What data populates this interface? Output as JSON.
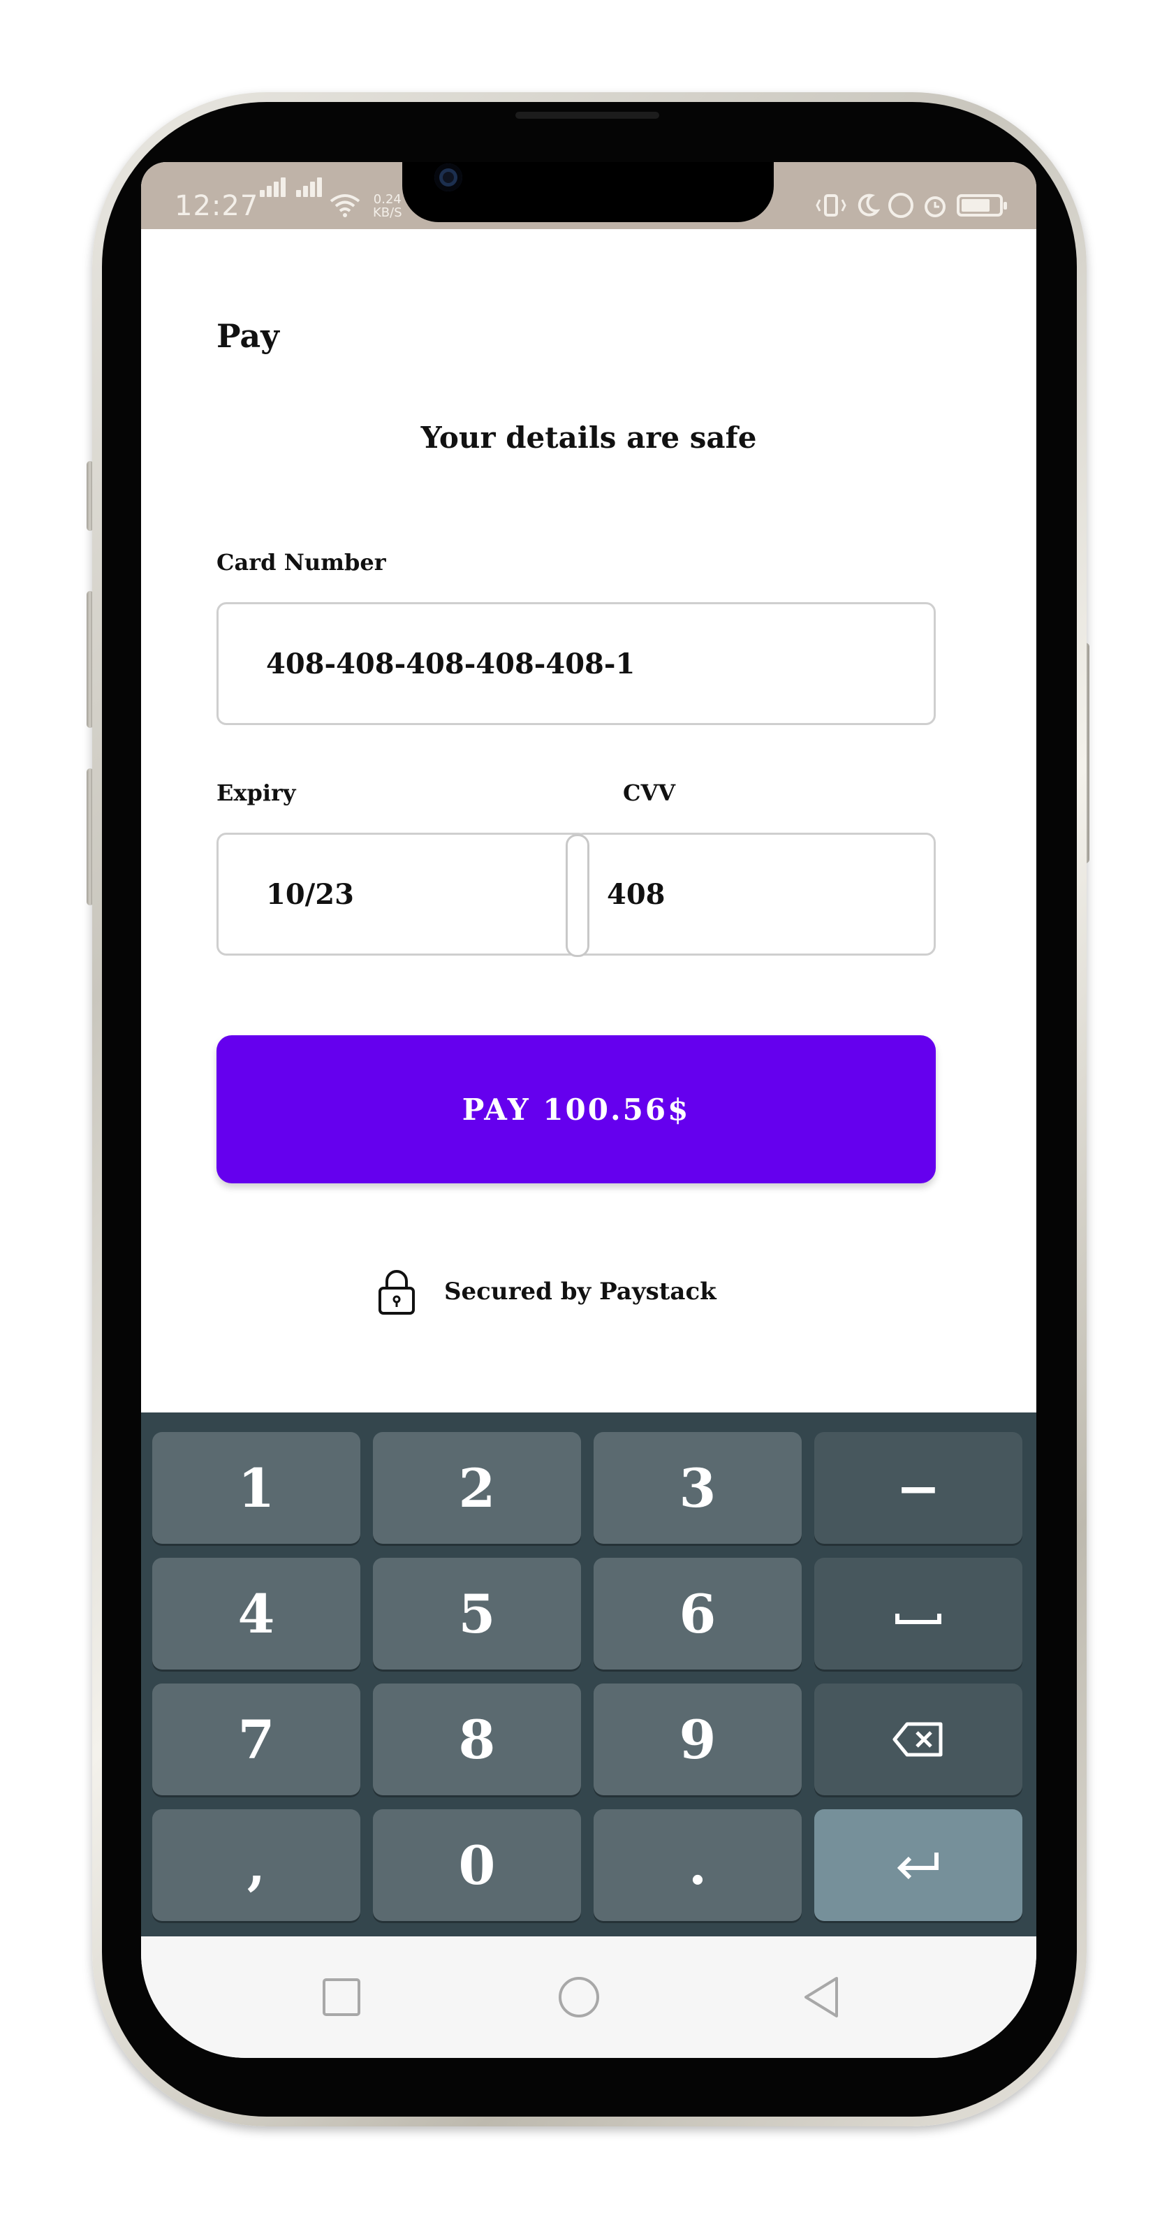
{
  "status_bar": {
    "time": "12:27",
    "speed_value": "0.24",
    "speed_unit": "KB/S",
    "icons": [
      "signal-icon",
      "signal-icon",
      "wifi-icon",
      "vibrate-icon",
      "moon-icon",
      "lock-rotation-icon",
      "alarm-icon",
      "battery-icon"
    ]
  },
  "app": {
    "title": "Pay",
    "subtitle": "Your details are safe",
    "card_number": {
      "label": "Card Number",
      "value": "408-408-408-408-408-1"
    },
    "expiry": {
      "label": "Expiry",
      "value": "10/23"
    },
    "cvv": {
      "label": "CVV",
      "value": "408"
    },
    "pay_button": "PAY 100.56$",
    "secured_text": "Secured by Paystack",
    "accent_color": "#6500ee"
  },
  "keyboard": {
    "keys": [
      "1",
      "2",
      "3",
      "−",
      "4",
      "5",
      "6",
      "space",
      "7",
      "8",
      "9",
      "backspace",
      ",",
      "0",
      ".",
      "enter"
    ],
    "labels": {
      "k1": "1",
      "k2": "2",
      "k3": "3",
      "minus": "−",
      "k4": "4",
      "k5": "5",
      "k6": "6",
      "k7": "7",
      "k8": "8",
      "k9": "9",
      "comma": ",",
      "k0": "0",
      "period": "."
    }
  },
  "nav_bar": {
    "buttons": [
      "recents-button",
      "home-button",
      "back-button"
    ]
  }
}
